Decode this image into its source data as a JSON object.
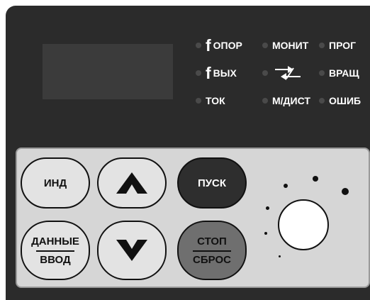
{
  "indicators": {
    "f_opor": {
      "symbol": "f",
      "label": "ОПОР"
    },
    "monit": {
      "label": "МОНИТ"
    },
    "prog": {
      "label": "ПРОГ"
    },
    "f_vyh": {
      "symbol": "f",
      "label": "ВЫХ"
    },
    "vrash": {
      "label": "ВРАЩ"
    },
    "tok": {
      "label": "ТОК"
    },
    "m_dist": {
      "label": "М/ДИСТ"
    },
    "oshib": {
      "label": "ОШИБ"
    }
  },
  "keys": {
    "ind": "ИНД",
    "dannye": "ДАННЫЕ",
    "vvod": "ВВОД",
    "pusk": "ПУСК",
    "stop": "СТОП",
    "sbros": "СБРОС"
  },
  "colors": {
    "panel": "#2b2b2b",
    "keypad": "#d6d6d6",
    "pusk_key": "#2e2e2e",
    "stop_key": "#6f6f6f",
    "led_off": "#4a4a4a"
  },
  "icons": {
    "arrow_up": "up-arrow",
    "arrow_down": "down-arrow",
    "direction": "forward-reverse-arrows"
  }
}
